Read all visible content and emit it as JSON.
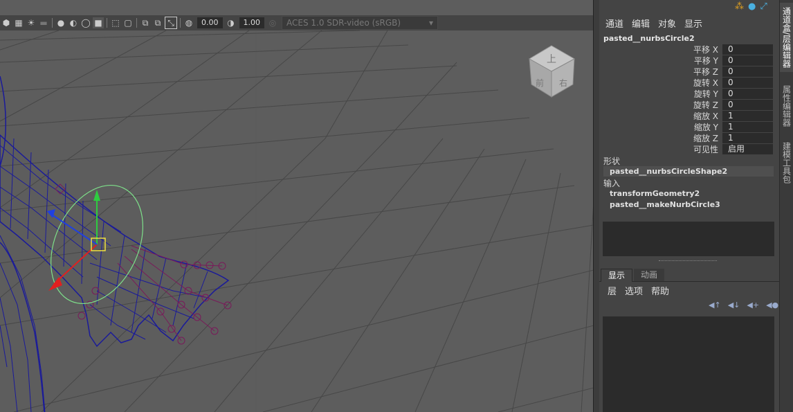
{
  "toolbar": {
    "exposure_value": "0.00",
    "gamma_value": "1.00",
    "colorspace": "ACES 1.0 SDR-video (sRGB)",
    "icons": [
      "smooth-shade-icon",
      "wireframe-icon",
      "light-icon",
      "shadow-icon",
      "isolate-icon",
      "xray-icon",
      "joint-icon",
      "grid-icon",
      "resolution-gate-icon",
      "camera-icon",
      "film-gate-icon",
      "gate-mask-icon",
      "exposure-icon",
      "gamma-icon",
      "color-management-icon"
    ]
  },
  "viewcube": {
    "top_label": "上",
    "front_label": "前",
    "right_label": "右"
  },
  "channel_box": {
    "menu": [
      "通道",
      "编辑",
      "对象",
      "显示"
    ],
    "object_name": "pasted__nurbsCircle2",
    "attributes": [
      {
        "label": "平移 X",
        "value": "0"
      },
      {
        "label": "平移 Y",
        "value": "0"
      },
      {
        "label": "平移 Z",
        "value": "0"
      },
      {
        "label": "旋转 X",
        "value": "0"
      },
      {
        "label": "旋转 Y",
        "value": "0"
      },
      {
        "label": "旋转 Z",
        "value": "0"
      },
      {
        "label": "缩放 X",
        "value": "1"
      },
      {
        "label": "缩放 Y",
        "value": "1"
      },
      {
        "label": "缩放 Z",
        "value": "1"
      },
      {
        "label": "可见性",
        "value": "启用"
      }
    ],
    "shapes_label": "形状",
    "shape_node": "pasted__nurbsCircleShape2",
    "inputs_label": "输入",
    "input_nodes": [
      "transformGeometry2",
      "pasted__makeNurbCircle3"
    ]
  },
  "layer_editor": {
    "tabs": [
      "显示",
      "动画"
    ],
    "menu": [
      "层",
      "选项",
      "帮助"
    ],
    "icons": [
      "move-layer-up-icon",
      "move-layer-down-icon",
      "new-empty-layer-icon",
      "new-layer-selected-icon"
    ]
  },
  "side_tabs": [
    "通道盒/层编辑器",
    "属性编辑器",
    "建模工具包"
  ],
  "colors": {
    "viewport_bg": "#5d5d5d",
    "wireframe": "#1a1a9a",
    "panel_bg": "#444444"
  }
}
